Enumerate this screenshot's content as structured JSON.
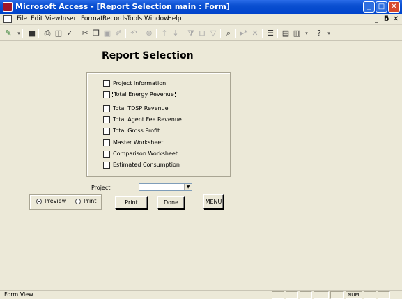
{
  "window": {
    "title": "Microsoft Access - [Report Selection main : Form]"
  },
  "menu": {
    "items": [
      "File",
      "Edit",
      "View",
      "Insert",
      "Format",
      "Records",
      "Tools",
      "Window",
      "Help"
    ],
    "mdi_controls": [
      "_",
      "̅̅",
      "x"
    ]
  },
  "form": {
    "heading": "Report Selection",
    "reports": [
      "Project Information",
      "Total Energy Revenue",
      "Total TDSP  Revenue",
      "Total Agent Fee Revenue",
      "Total Gross Profit",
      "Master Worksheet",
      "Comparison Worksheet",
      "Estimated Consumption"
    ],
    "project_label": "Project",
    "project_value": "",
    "output_options": {
      "preview": "Preview",
      "print": "Print",
      "selected": "Preview"
    },
    "buttons": {
      "print": "Print",
      "done": "Done",
      "menu": "MENU"
    }
  },
  "status": {
    "text": "Form View",
    "num": "NUM"
  }
}
